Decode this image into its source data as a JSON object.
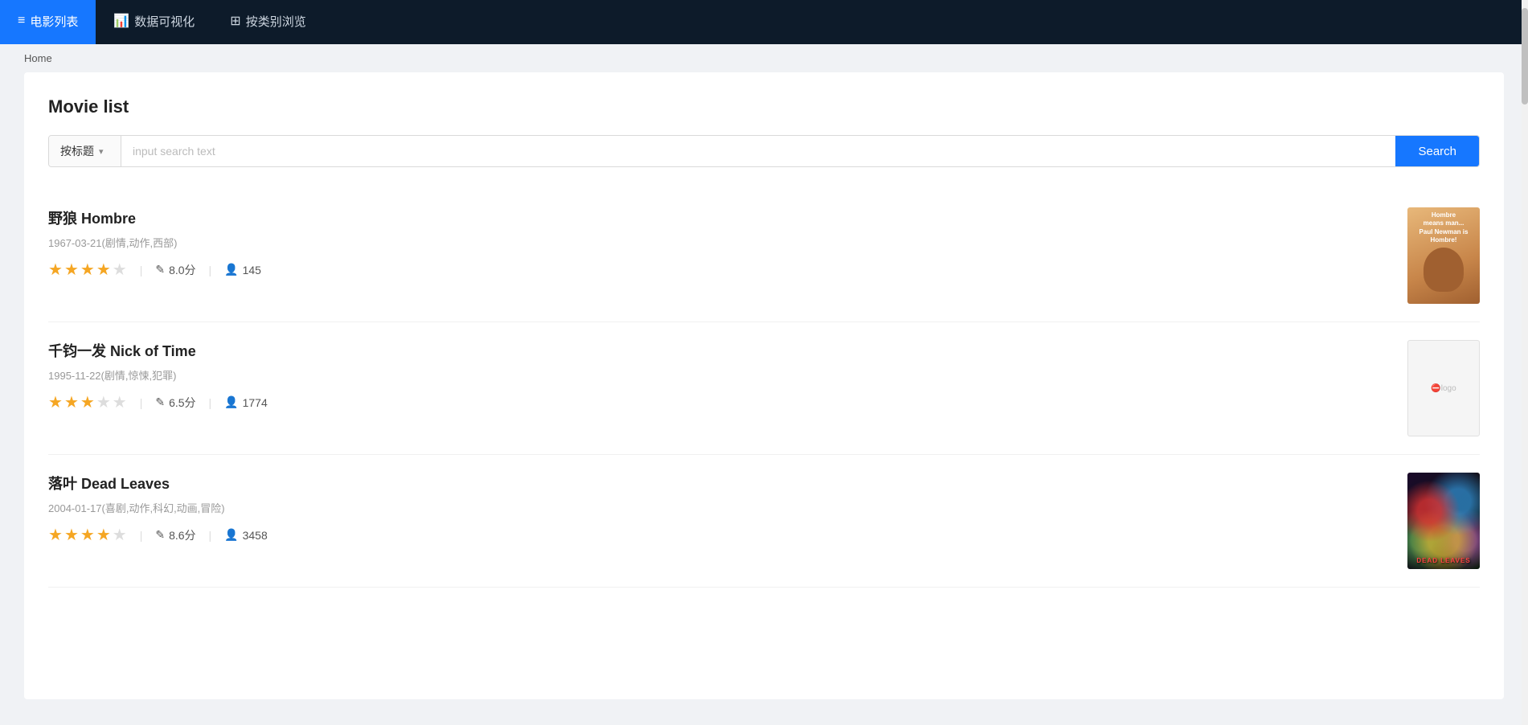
{
  "navbar": {
    "items": [
      {
        "id": "movies",
        "label": "电影列表",
        "icon": "≡",
        "active": true
      },
      {
        "id": "dataviz",
        "label": "数据可视化",
        "icon": "📊",
        "active": false
      },
      {
        "id": "browse",
        "label": "按类别浏览",
        "icon": "⊞",
        "active": false
      }
    ]
  },
  "breadcrumb": {
    "text": "Home"
  },
  "main": {
    "title": "Movie list",
    "search": {
      "dropdown_label": "按标题",
      "placeholder": "input search text",
      "button_label": "Search"
    },
    "movies": [
      {
        "id": 1,
        "title": "野狼 Hombre",
        "date": "1967-03-21",
        "genres": "剧情,动作,西部",
        "stars_filled": 4,
        "stars_empty": 1,
        "score": "8.0分",
        "count": "145",
        "poster_type": "hombre"
      },
      {
        "id": 2,
        "title": "千钧一发 Nick of Time",
        "date": "1995-11-22",
        "genres": "剧情,惊悚,犯罪",
        "stars_filled": 3,
        "stars_empty": 2,
        "score": "6.5分",
        "count": "1774",
        "poster_type": "broken"
      },
      {
        "id": 3,
        "title": "落叶 Dead Leaves",
        "date": "2004-01-17",
        "genres": "喜剧,动作,科幻,动画,冒险",
        "stars_filled": 4,
        "stars_empty": 1,
        "score": "8.6分",
        "count": "3458",
        "poster_type": "deadleaves"
      }
    ]
  },
  "icons": {
    "pencil": "✎",
    "user": "👤",
    "barchart": "📊",
    "grid": "⊞",
    "menu": "≡"
  }
}
